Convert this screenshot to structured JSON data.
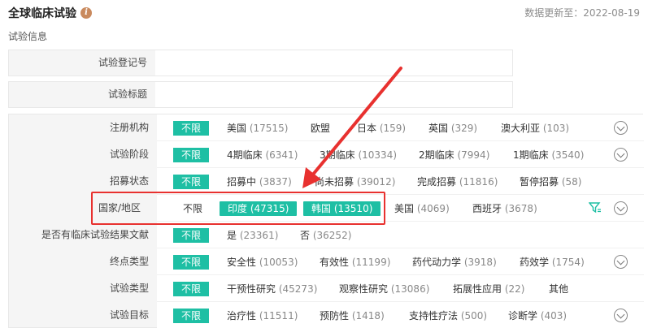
{
  "header": {
    "title": "全球临床试验",
    "info_icon": "info-icon",
    "info_glyph": "i",
    "update_date": "数据更新至：2022-08-19"
  },
  "section_title": "试验信息",
  "inputs": [
    {
      "label": "试验登记号",
      "value": ""
    },
    {
      "label": "试验标题",
      "value": ""
    }
  ],
  "filters": {
    "registry": {
      "label": "注册机构",
      "unlimited": "不限",
      "options": [
        {
          "name": "美国",
          "count": "(17515)"
        },
        {
          "name": "欧盟",
          "count": ""
        },
        {
          "name": "日本",
          "count": "(159)"
        },
        {
          "name": "英国",
          "count": "(329)"
        },
        {
          "name": "澳大利亚",
          "count": "(103)"
        }
      ]
    },
    "phase": {
      "label": "试验阶段",
      "unlimited": "不限",
      "options": [
        {
          "name": "4期临床",
          "count": "(6341)"
        },
        {
          "name": "3期临床",
          "count": "(10334)"
        },
        {
          "name": "2期临床",
          "count": "(7994)"
        },
        {
          "name": "1期临床",
          "count": "(3540)"
        }
      ]
    },
    "recruit": {
      "label": "招募状态",
      "unlimited": "不限",
      "options": [
        {
          "name": "招募中",
          "count": "(3837)"
        },
        {
          "name": "尚未招募",
          "count": "(39012)"
        },
        {
          "name": "完成招募",
          "count": "(11816)"
        },
        {
          "name": "暂停招募",
          "count": "(58)"
        }
      ]
    },
    "country": {
      "label": "国家/地区",
      "unlimited": "不限",
      "options": [
        {
          "name": "印度",
          "count": "(47315)",
          "selected": true
        },
        {
          "name": "韩国",
          "count": "(13510)",
          "selected": true
        },
        {
          "name": "美国",
          "count": "(4069)"
        },
        {
          "name": "西班牙",
          "count": "(3678)"
        }
      ]
    },
    "results": {
      "label": "是否有临床试验结果文献",
      "unlimited": "不限",
      "options": [
        {
          "name": "是",
          "count": "(23361)"
        },
        {
          "name": "否",
          "count": "(36252)"
        }
      ]
    },
    "endpoint": {
      "label": "终点类型",
      "unlimited": "不限",
      "options": [
        {
          "name": "安全性",
          "count": "(10053)"
        },
        {
          "name": "有效性",
          "count": "(11199)"
        },
        {
          "name": "药代动力学",
          "count": "(3918)"
        },
        {
          "name": "药效学",
          "count": "(1754)"
        }
      ]
    },
    "type": {
      "label": "试验类型",
      "unlimited": "不限",
      "options": [
        {
          "name": "干预性研究",
          "count": "(45273)"
        },
        {
          "name": "观察性研究",
          "count": "(13086)"
        },
        {
          "name": "拓展性应用",
          "count": "(22)"
        },
        {
          "name": "其他",
          "count": ""
        }
      ]
    },
    "target": {
      "label": "试验目标",
      "unlimited": "不限",
      "options": [
        {
          "name": "治疗性",
          "count": "(11511)"
        },
        {
          "name": "预防性",
          "count": "(1418)"
        },
        {
          "name": "支持性疗法",
          "count": "(500)"
        },
        {
          "name": "诊断学",
          "count": "(403)"
        }
      ]
    }
  },
  "colors": {
    "accent": "#1ebfa4",
    "annotation": "#e8312f"
  }
}
